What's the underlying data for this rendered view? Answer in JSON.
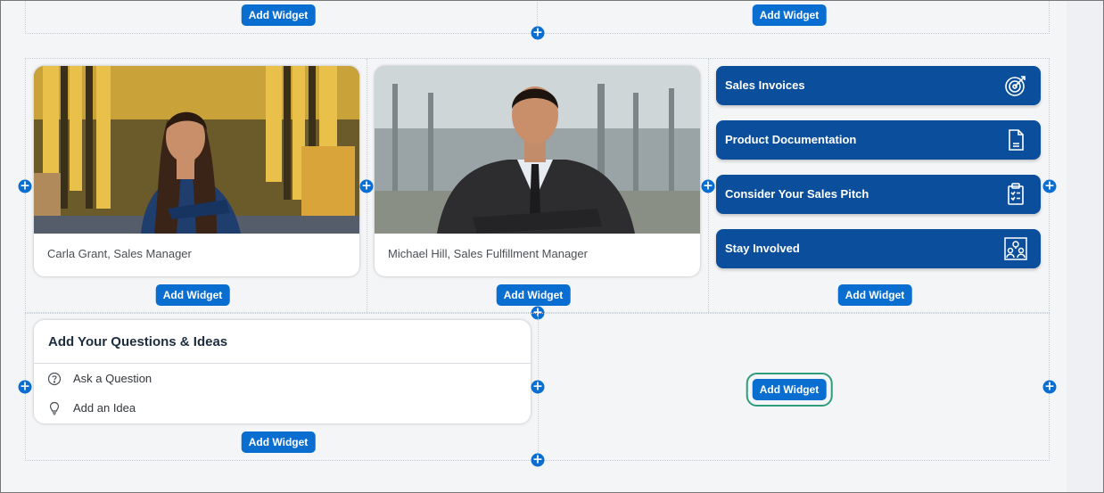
{
  "top_row": {
    "add_widget_left": "Add Widget",
    "add_widget_right": "Add Widget"
  },
  "people": [
    {
      "name": "Carla Grant, Sales Manager",
      "add_widget": "Add Widget"
    },
    {
      "name": "Michael Hill, Sales Fulfillment Manager",
      "add_widget": "Add Widget"
    }
  ],
  "quick_links": {
    "tiles": [
      {
        "label": "Sales Invoices",
        "icon": "target-icon"
      },
      {
        "label": "Product Documentation",
        "icon": "document-icon"
      },
      {
        "label": "Consider Your Sales Pitch",
        "icon": "clipboard-checklist-icon"
      },
      {
        "label": "Stay Involved",
        "icon": "people-location-icon"
      }
    ],
    "add_widget": "Add Widget"
  },
  "questions_card": {
    "title": "Add Your Questions & Ideas",
    "items": [
      {
        "label": "Ask a Question",
        "icon": "question-circle-icon"
      },
      {
        "label": "Add an Idea",
        "icon": "lightbulb-icon"
      }
    ],
    "add_widget": "Add Widget"
  },
  "empty_cell": {
    "add_widget": "Add Widget",
    "highlighted": true
  },
  "colors": {
    "accent": "#0a6ed1",
    "tile": "#0b4f9c",
    "highlight": "#2f9d7c",
    "background": "#f4f5f7"
  }
}
